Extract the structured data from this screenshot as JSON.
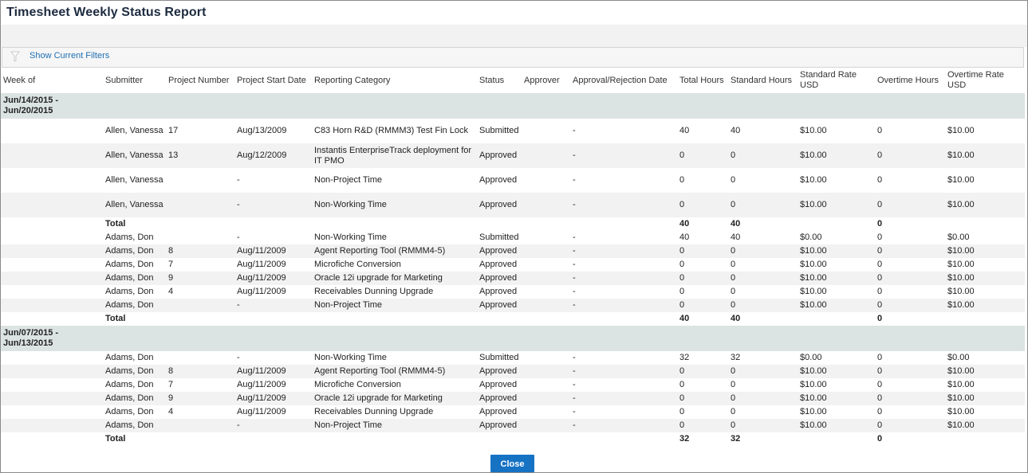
{
  "title": "Timesheet Weekly Status Report",
  "filter_link": "Show Current Filters",
  "headers": [
    "Week of",
    "Submitter",
    "Project Number",
    "Project Start Date",
    "Reporting Category",
    "Status",
    "Approver",
    "Approval/Rejection Date",
    "Total Hours",
    "Standard Hours",
    "Standard Rate USD",
    "Overtime Hours",
    "Overtime Rate USD"
  ],
  "groups": [
    {
      "week": "Jun/14/2015 - Jun/20/2015",
      "rows": [
        [
          "Allen, Vanessa",
          "17",
          "Aug/13/2009",
          "C83 Horn R&D (RMMM3) Test Fin Lock",
          "Submitted",
          "",
          "-",
          "40",
          "40",
          "$10.00",
          "0",
          "$10.00"
        ],
        [
          "Allen, Vanessa",
          "13",
          "Aug/12/2009",
          "Instantis EnterpriseTrack deployment for IT PMO",
          "Approved",
          "",
          "-",
          "0",
          "0",
          "$10.00",
          "0",
          "$10.00"
        ],
        [
          "Allen, Vanessa",
          "",
          "-",
          "Non-Project Time",
          "Approved",
          "",
          "-",
          "0",
          "0",
          "$10.00",
          "0",
          "$10.00"
        ],
        [
          "Allen, Vanessa",
          "",
          "-",
          "Non-Working Time",
          "Approved",
          "",
          "-",
          "0",
          "0",
          "$10.00",
          "0",
          "$10.00"
        ]
      ],
      "total": {
        "label": "Total",
        "total_hours": "40",
        "standard_hours": "40",
        "overtime_hours": "0"
      },
      "rows2": [
        [
          "Adams, Don",
          "",
          "-",
          "Non-Working Time",
          "Submitted",
          "",
          "-",
          "40",
          "40",
          "$0.00",
          "0",
          "$0.00"
        ],
        [
          "Adams, Don",
          "8",
          "Aug/11/2009",
          "Agent Reporting Tool (RMMM4-5)",
          "Approved",
          "",
          "-",
          "0",
          "0",
          "$10.00",
          "0",
          "$10.00"
        ],
        [
          "Adams, Don",
          "7",
          "Aug/11/2009",
          "Microfiche Conversion",
          "Approved",
          "",
          "-",
          "0",
          "0",
          "$10.00",
          "0",
          "$10.00"
        ],
        [
          "Adams, Don",
          "9",
          "Aug/11/2009",
          "Oracle 12i upgrade for Marketing",
          "Approved",
          "",
          "-",
          "0",
          "0",
          "$10.00",
          "0",
          "$10.00"
        ],
        [
          "Adams, Don",
          "4",
          "Aug/11/2009",
          "Receivables Dunning Upgrade",
          "Approved",
          "",
          "-",
          "0",
          "0",
          "$10.00",
          "0",
          "$10.00"
        ],
        [
          "Adams, Don",
          "",
          "-",
          "Non-Project Time",
          "Approved",
          "",
          "-",
          "0",
          "0",
          "$10.00",
          "0",
          "$10.00"
        ]
      ],
      "total2": {
        "label": "Total",
        "total_hours": "40",
        "standard_hours": "40",
        "overtime_hours": "0"
      }
    },
    {
      "week": "Jun/07/2015 - Jun/13/2015",
      "rows": [
        [
          "Adams, Don",
          "",
          "-",
          "Non-Working Time",
          "Submitted",
          "",
          "-",
          "32",
          "32",
          "$0.00",
          "0",
          "$0.00"
        ],
        [
          "Adams, Don",
          "8",
          "Aug/11/2009",
          "Agent Reporting Tool (RMMM4-5)",
          "Approved",
          "",
          "-",
          "0",
          "0",
          "$10.00",
          "0",
          "$10.00"
        ],
        [
          "Adams, Don",
          "7",
          "Aug/11/2009",
          "Microfiche Conversion",
          "Approved",
          "",
          "-",
          "0",
          "0",
          "$10.00",
          "0",
          "$10.00"
        ],
        [
          "Adams, Don",
          "9",
          "Aug/11/2009",
          "Oracle 12i upgrade for Marketing",
          "Approved",
          "",
          "-",
          "0",
          "0",
          "$10.00",
          "0",
          "$10.00"
        ],
        [
          "Adams, Don",
          "4",
          "Aug/11/2009",
          "Receivables Dunning Upgrade",
          "Approved",
          "",
          "-",
          "0",
          "0",
          "$10.00",
          "0",
          "$10.00"
        ],
        [
          "Adams, Don",
          "",
          "-",
          "Non-Project Time",
          "Approved",
          "",
          "-",
          "0",
          "0",
          "$10.00",
          "0",
          "$10.00"
        ]
      ],
      "total": {
        "label": "Total",
        "total_hours": "32",
        "standard_hours": "32",
        "overtime_hours": "0"
      }
    }
  ],
  "close_label": "Close",
  "colors": {
    "accent": "#1673c4",
    "group_bg": "#dce3e3",
    "title": "#1d2b40",
    "link": "#1f6fb2"
  },
  "icons": {
    "filter": "filter-funnel-icon"
  }
}
